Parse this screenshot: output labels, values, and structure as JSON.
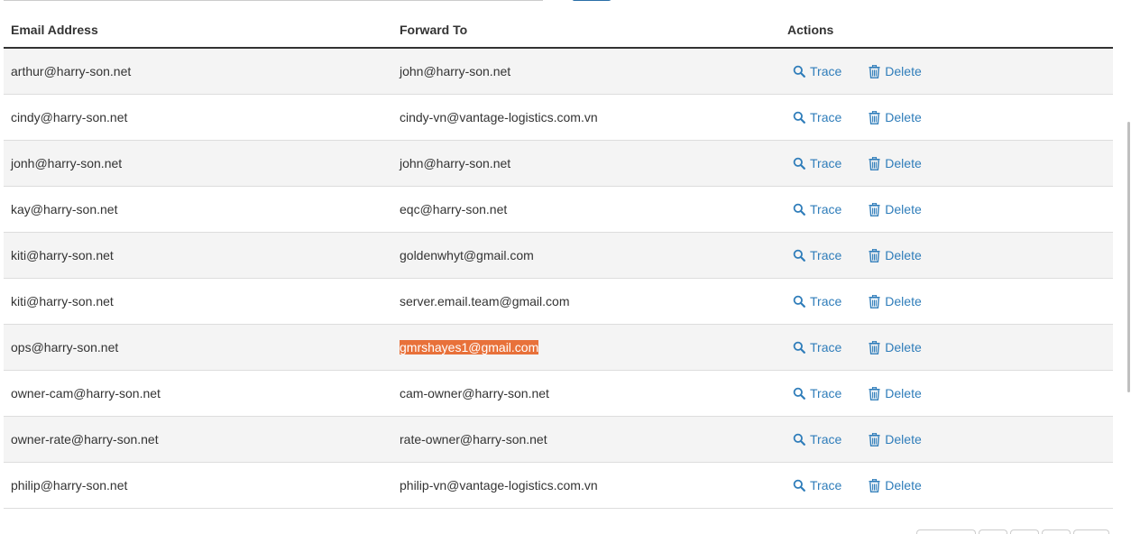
{
  "table": {
    "headers": {
      "email": "Email Address",
      "forward": "Forward To",
      "actions": "Actions"
    },
    "action_labels": {
      "trace": "Trace",
      "delete": "Delete"
    },
    "rows": [
      {
        "email": "arthur@harry-son.net",
        "forward": "john@harry-son.net"
      },
      {
        "email": "cindy@harry-son.net",
        "forward": "cindy-vn@vantage-logistics.com.vn"
      },
      {
        "email": "jonh@harry-son.net",
        "forward": "john@harry-son.net"
      },
      {
        "email": "kay@harry-son.net",
        "forward": "eqc@harry-son.net"
      },
      {
        "email": "kiti@harry-son.net",
        "forward": "goldenwhyt@gmail.com"
      },
      {
        "email": "kiti@harry-son.net",
        "forward": "server.email.team@gmail.com"
      },
      {
        "email": "ops@harry-son.net",
        "forward": "gmrshayes1@gmail.com",
        "highlighted": true
      },
      {
        "email": "owner-cam@harry-son.net",
        "forward": "cam-owner@harry-son.net"
      },
      {
        "email": "owner-rate@harry-son.net",
        "forward": "rate-owner@harry-son.net"
      },
      {
        "email": "philip@harry-son.net",
        "forward": "philip-vn@vantage-logistics.com.vn"
      }
    ]
  },
  "icons": {
    "trace": "search-icon",
    "delete": "trash-icon"
  },
  "colors": {
    "link": "#2f7dba",
    "highlight": "#e8713a",
    "row_stripe": "#f4f4f4"
  }
}
